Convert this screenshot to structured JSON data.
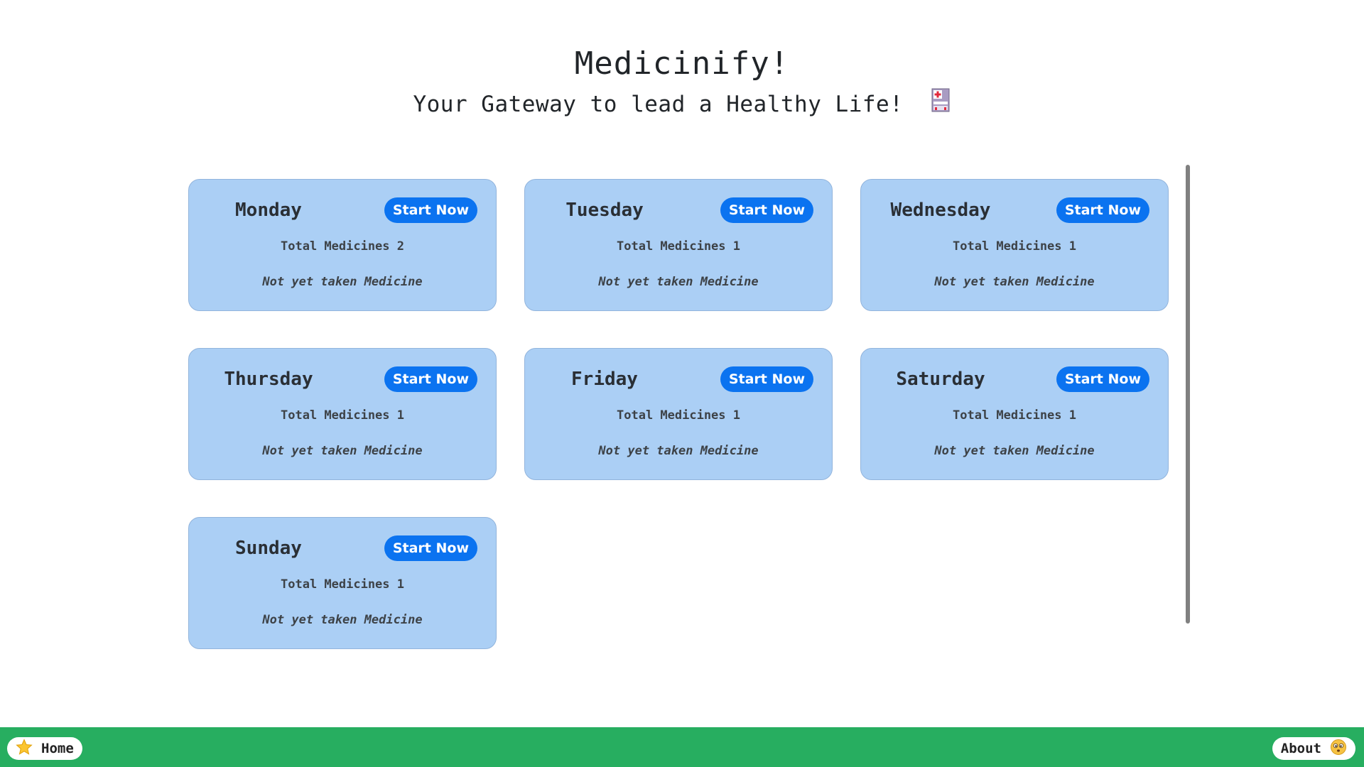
{
  "header": {
    "title": "Medicinify!",
    "tagline": "Your Gateway to lead a Healthy Life!"
  },
  "days": [
    {
      "name": "Monday",
      "button": "Start Now",
      "total": "Total Medicines 2",
      "status": "Not yet taken Medicine"
    },
    {
      "name": "Tuesday",
      "button": "Start Now",
      "total": "Total Medicines 1",
      "status": "Not yet taken Medicine"
    },
    {
      "name": "Wednesday",
      "button": "Start Now",
      "total": "Total Medicines 1",
      "status": "Not yet taken Medicine"
    },
    {
      "name": "Thursday",
      "button": "Start Now",
      "total": "Total Medicines 1",
      "status": "Not yet taken Medicine"
    },
    {
      "name": "Friday",
      "button": "Start Now",
      "total": "Total Medicines 1",
      "status": "Not yet taken Medicine"
    },
    {
      "name": "Saturday",
      "button": "Start Now",
      "total": "Total Medicines 1",
      "status": "Not yet taken Medicine"
    },
    {
      "name": "Sunday",
      "button": "Start Now",
      "total": "Total Medicines 1",
      "status": "Not yet taken Medicine"
    }
  ],
  "footer": {
    "home_label": "Home",
    "home_icon": "star-icon",
    "about_label": "About",
    "about_icon": "face-icon"
  },
  "icons": {
    "tagline_icon": "hospital-icon"
  },
  "colors": {
    "card_bg": "#abcff5",
    "button": "#0b73f0",
    "footer": "#27ae60"
  }
}
